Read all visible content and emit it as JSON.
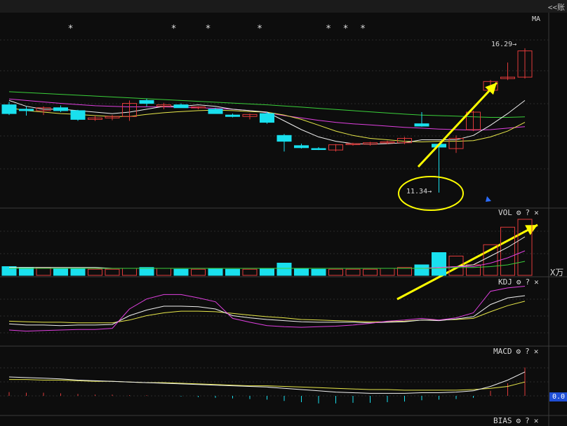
{
  "header": {
    "tab_label": "<<账"
  },
  "price_panel": {
    "indicator_label": "MA",
    "star_glyph": "*",
    "high_label": "16.29",
    "low_label": "11.34",
    "arrow_glyph": "→"
  },
  "volume_panel": {
    "indicator_label": "VOL",
    "unit_label": "X万"
  },
  "kdj_panel": {
    "indicator_label": "KDJ"
  },
  "macd_panel": {
    "indicator_label": "MACD",
    "axis_value": "0.0"
  },
  "bias_panel": {
    "indicator_label": "BIAS"
  },
  "controls": {
    "settings_glyph": "⚙",
    "help_glyph": "?",
    "close_glyph": "✕"
  },
  "colors": {
    "up": "#e03a3a",
    "down": "#19e0ee",
    "ma_white": "#f0f0f0",
    "ma_yellow": "#e8e84a",
    "ma_magenta": "#e040e0",
    "ma_green": "#3ad03a",
    "annotation": "#ffff00"
  },
  "chart_data": {
    "type": "candlestick",
    "candles": [
      {
        "o": 14.35,
        "h": 14.45,
        "l": 14.0,
        "c": 14.05
      },
      {
        "o": 14.2,
        "h": 14.3,
        "l": 13.98,
        "c": 14.15
      },
      {
        "o": 14.15,
        "h": 14.3,
        "l": 14.0,
        "c": 14.25
      },
      {
        "o": 14.25,
        "h": 14.33,
        "l": 14.1,
        "c": 14.15
      },
      {
        "o": 14.15,
        "h": 14.18,
        "l": 13.8,
        "c": 13.85
      },
      {
        "o": 13.85,
        "h": 13.98,
        "l": 13.8,
        "c": 13.9
      },
      {
        "o": 13.9,
        "h": 14.0,
        "l": 13.82,
        "c": 13.95
      },
      {
        "o": 13.95,
        "h": 14.5,
        "l": 13.8,
        "c": 14.4
      },
      {
        "o": 14.5,
        "h": 14.56,
        "l": 14.3,
        "c": 14.4
      },
      {
        "o": 14.3,
        "h": 14.42,
        "l": 14.2,
        "c": 14.35
      },
      {
        "o": 14.35,
        "h": 14.4,
        "l": 14.25,
        "c": 14.25
      },
      {
        "o": 14.25,
        "h": 14.3,
        "l": 14.2,
        "c": 14.28
      },
      {
        "o": 14.2,
        "h": 14.25,
        "l": 14.05,
        "c": 14.05
      },
      {
        "o": 14.0,
        "h": 14.05,
        "l": 13.92,
        "c": 13.95
      },
      {
        "o": 13.95,
        "h": 14.05,
        "l": 13.85,
        "c": 14.02
      },
      {
        "o": 14.05,
        "h": 14.1,
        "l": 13.7,
        "c": 13.75
      },
      {
        "o": 13.3,
        "h": 13.35,
        "l": 12.75,
        "c": 13.1
      },
      {
        "o": 12.95,
        "h": 13.02,
        "l": 12.85,
        "c": 12.88
      },
      {
        "o": 12.85,
        "h": 12.9,
        "l": 12.8,
        "c": 12.82
      },
      {
        "o": 12.8,
        "h": 13.0,
        "l": 12.75,
        "c": 12.98
      },
      {
        "o": 13.0,
        "h": 13.05,
        "l": 12.95,
        "c": 13.02
      },
      {
        "o": 13.0,
        "h": 13.08,
        "l": 12.95,
        "c": 13.05
      },
      {
        "o": 13.05,
        "h": 13.12,
        "l": 13.0,
        "c": 13.08
      },
      {
        "o": 13.05,
        "h": 13.25,
        "l": 13.0,
        "c": 13.2
      },
      {
        "o": 13.7,
        "h": 14.1,
        "l": 13.6,
        "c": 13.62
      },
      {
        "o": 13.0,
        "h": 13.02,
        "l": 11.34,
        "c": 12.9
      },
      {
        "o": 12.85,
        "h": 13.3,
        "l": 12.7,
        "c": 13.2
      },
      {
        "o": 13.5,
        "h": 14.15,
        "l": 13.45,
        "c": 14.1
      },
      {
        "o": 14.85,
        "h": 15.2,
        "l": 14.8,
        "c": 15.15
      },
      {
        "o": 15.25,
        "h": 15.8,
        "l": 15.2,
        "c": 15.3
      },
      {
        "o": 15.3,
        "h": 16.29,
        "l": 15.25,
        "c": 16.2
      }
    ],
    "ma_short": [
      14.5,
      14.3,
      14.2,
      14.2,
      14.15,
      14.1,
      14.05,
      14.1,
      14.2,
      14.3,
      14.3,
      14.35,
      14.3,
      14.2,
      14.15,
      14.1,
      13.8,
      13.5,
      13.25,
      13.1,
      13.02,
      13.0,
      13.02,
      13.05,
      13.15,
      13.15,
      13.15,
      13.3,
      13.65,
      14.05,
      14.5
    ],
    "ma_mid": [
      14.25,
      14.15,
      14.1,
      14.05,
      14.02,
      13.98,
      13.95,
      13.95,
      14.02,
      14.08,
      14.12,
      14.15,
      14.17,
      14.15,
      14.12,
      14.1,
      14.0,
      13.85,
      13.65,
      13.45,
      13.3,
      13.2,
      13.15,
      13.1,
      13.08,
      13.1,
      13.1,
      13.12,
      13.25,
      13.45,
      13.75
    ],
    "ma_long": [
      14.55,
      14.5,
      14.45,
      14.4,
      14.36,
      14.32,
      14.3,
      14.28,
      14.28,
      14.28,
      14.27,
      14.25,
      14.23,
      14.2,
      14.15,
      14.08,
      13.98,
      13.9,
      13.82,
      13.75,
      13.7,
      13.66,
      13.62,
      13.58,
      13.55,
      13.52,
      13.5,
      13.48,
      13.5,
      13.55,
      13.6
    ],
    "ma_longest": [
      14.8,
      14.77,
      14.74,
      14.71,
      14.68,
      14.65,
      14.62,
      14.59,
      14.56,
      14.53,
      14.5,
      14.47,
      14.44,
      14.41,
      14.38,
      14.35,
      14.31,
      14.27,
      14.23,
      14.19,
      14.15,
      14.11,
      14.07,
      14.03,
      14.0,
      13.98,
      13.96,
      13.94,
      13.92,
      13.92,
      13.94
    ],
    "volume": [
      10,
      9,
      9,
      8,
      8,
      7,
      7,
      8,
      9,
      8,
      7,
      7,
      8,
      7,
      7,
      8,
      14,
      8,
      7,
      7,
      7,
      7,
      8,
      9,
      12,
      26,
      22,
      12,
      35,
      55,
      64
    ],
    "vol_ma_a": [
      9,
      9,
      9,
      9,
      9,
      9,
      8,
      8,
      8,
      8,
      8,
      8,
      8,
      8,
      8,
      8,
      8,
      8,
      8,
      8,
      8,
      8,
      8,
      8,
      8,
      9,
      10,
      12,
      22,
      32,
      44
    ],
    "vol_ma_b": [
      8,
      8,
      8,
      8,
      8,
      8,
      8,
      8,
      8,
      8,
      8,
      8,
      8,
      8,
      8,
      8,
      8,
      8,
      8,
      8,
      8,
      8,
      8,
      8,
      8,
      9,
      10,
      10,
      14,
      20,
      28
    ],
    "vol_ma_c": [
      8,
      8,
      8,
      8,
      8,
      8,
      8,
      8,
      8,
      8,
      8,
      8,
      8,
      8,
      8,
      8,
      8,
      8,
      8,
      8,
      8,
      8,
      8,
      8,
      8,
      8,
      9,
      9,
      10,
      12,
      16
    ],
    "kdj_k": [
      35,
      33,
      33,
      32,
      33,
      33,
      34,
      50,
      60,
      67,
      67,
      66,
      62,
      50,
      46,
      43,
      41,
      39,
      38,
      38,
      38,
      37,
      38,
      39,
      42,
      41,
      44,
      48,
      70,
      82,
      86
    ],
    "kdj_d": [
      40,
      39,
      38,
      38,
      37,
      37,
      37,
      42,
      50,
      55,
      58,
      58,
      57,
      54,
      51,
      48,
      46,
      43,
      42,
      41,
      40,
      39,
      39,
      40,
      42,
      42,
      43,
      45,
      57,
      68,
      76
    ],
    "kdj_j": [
      24,
      22,
      23,
      24,
      25,
      25,
      27,
      62,
      80,
      88,
      88,
      82,
      75,
      45,
      38,
      32,
      30,
      29,
      30,
      31,
      33,
      36,
      40,
      42,
      45,
      42,
      46,
      55,
      94,
      100,
      103
    ],
    "macd_dif": [
      30,
      29,
      28,
      27,
      25,
      24,
      23,
      22,
      21,
      20,
      19,
      18,
      17,
      16,
      15,
      14,
      12,
      10,
      8,
      6,
      5,
      4,
      4,
      4,
      5,
      5,
      6,
      8,
      15,
      25,
      38
    ],
    "macd_dea": [
      26,
      26,
      25,
      25,
      24,
      23,
      23,
      22,
      21,
      21,
      20,
      19,
      18,
      17,
      16,
      16,
      15,
      14,
      13,
      12,
      11,
      10,
      10,
      9,
      9,
      9,
      9,
      10,
      12,
      15,
      22
    ],
    "macd_hist": [
      6,
      5,
      5,
      4,
      3,
      2,
      2,
      1,
      1,
      0,
      -1,
      -2,
      -3,
      -4,
      -5,
      -6,
      -8,
      -10,
      -12,
      -12,
      -11,
      -11,
      -10,
      -9,
      -7,
      -6,
      -5,
      -3,
      8,
      20,
      45
    ],
    "stars_at_index": [
      3,
      9,
      11,
      14,
      18,
      19,
      20
    ],
    "ylim_price": [
      11.0,
      16.6
    ]
  }
}
